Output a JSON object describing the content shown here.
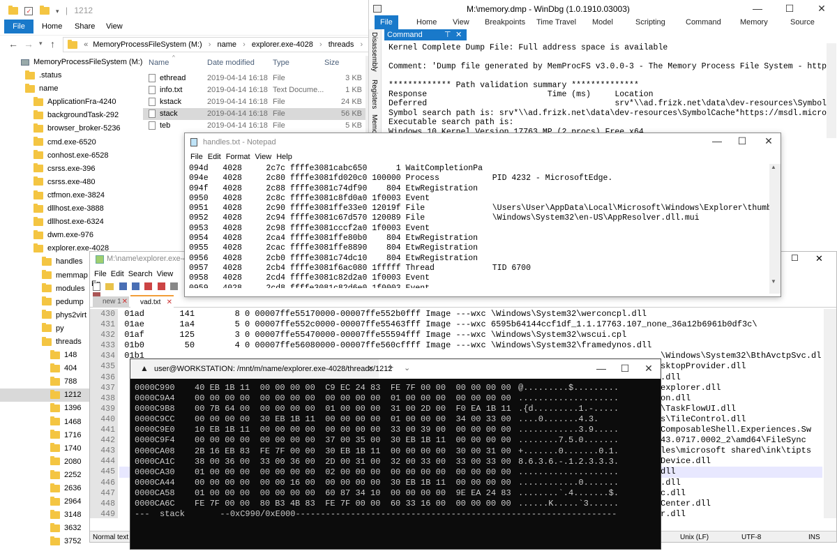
{
  "explorer": {
    "title": "1212",
    "ribbon_tabs": [
      "File",
      "Home",
      "Share",
      "View"
    ],
    "breadcrumb": [
      "MemoryProcessFileSystem (M:)",
      "name",
      "explorer.exe-4028",
      "threads",
      "1212"
    ],
    "breadcrumb_prefix": "«",
    "columns": [
      "Name",
      "Date modified",
      "Type",
      "Size"
    ],
    "files": [
      {
        "name": "ethread",
        "date": "2019-04-14 16:18",
        "type": "File",
        "size": "3 KB"
      },
      {
        "name": "info.txt",
        "date": "2019-04-14 16:18",
        "type": "Text Docume...",
        "size": "1 KB"
      },
      {
        "name": "kstack",
        "date": "2019-04-14 16:18",
        "type": "File",
        "size": "24 KB"
      },
      {
        "name": "stack",
        "date": "2019-04-14 16:18",
        "type": "File",
        "size": "56 KB"
      },
      {
        "name": "teb",
        "date": "2019-04-14 16:18",
        "type": "File",
        "size": "5 KB"
      }
    ],
    "tree": [
      {
        "label": "MemoryProcessFileSystem (M:)",
        "level": 0,
        "drive": true
      },
      {
        "label": ".status",
        "level": 1
      },
      {
        "label": "name",
        "level": 1
      },
      {
        "label": "ApplicationFra-4240",
        "level": 2
      },
      {
        "label": "backgroundTask-292",
        "level": 2
      },
      {
        "label": "browser_broker-5236",
        "level": 2
      },
      {
        "label": "cmd.exe-6520",
        "level": 2
      },
      {
        "label": "conhost.exe-6528",
        "level": 2
      },
      {
        "label": "csrss.exe-396",
        "level": 2
      },
      {
        "label": "csrss.exe-480",
        "level": 2
      },
      {
        "label": "ctfmon.exe-3824",
        "level": 2
      },
      {
        "label": "dllhost.exe-3888",
        "level": 2
      },
      {
        "label": "dllhost.exe-6324",
        "level": 2
      },
      {
        "label": "dwm.exe-976",
        "level": 2
      },
      {
        "label": "explorer.exe-4028",
        "level": 2
      },
      {
        "label": "handles",
        "level": 3
      },
      {
        "label": "memmap",
        "level": 3
      },
      {
        "label": "modules",
        "level": 3
      },
      {
        "label": "pedump",
        "level": 3
      },
      {
        "label": "phys2virt",
        "level": 3
      },
      {
        "label": "py",
        "level": 3
      },
      {
        "label": "threads",
        "level": 3
      },
      {
        "label": "148",
        "level": 4
      },
      {
        "label": "404",
        "level": 4
      },
      {
        "label": "788",
        "level": 4
      },
      {
        "label": "1212",
        "level": 4,
        "selected": true
      },
      {
        "label": "1396",
        "level": 4
      },
      {
        "label": "1468",
        "level": 4
      },
      {
        "label": "1716",
        "level": 4
      },
      {
        "label": "1740",
        "level": 4
      },
      {
        "label": "2080",
        "level": 4
      },
      {
        "label": "2252",
        "level": 4
      },
      {
        "label": "2636",
        "level": 4
      },
      {
        "label": "2964",
        "level": 4
      },
      {
        "label": "3148",
        "level": 4
      },
      {
        "label": "3632",
        "level": 4
      },
      {
        "label": "3752",
        "level": 4
      }
    ]
  },
  "windbg": {
    "title": "M:\\memory.dmp - WinDbg (1.0.1910.03003)",
    "ribbon_tabs": [
      "File",
      "Home",
      "View",
      "Breakpoints",
      "Time Travel",
      "Model",
      "Scripting",
      "Command",
      "Memory",
      "Source"
    ],
    "side_tabs": [
      "Disassembly",
      "Registers",
      "Memory"
    ],
    "panel_tab": "Command",
    "lines": [
      "Kernel Complete Dump File: Full address space is available",
      "",
      "Comment: 'Dump file generated by MemProcFS v3.0.0-3 - The Memory Process File System - https://githu",
      "",
      "************* Path validation summary **************",
      "Response                         Time (ms)     Location",
      "Deferred                                       srv*\\\\ad.frizk.net\\data\\dev-resources\\SymbolCache*htt",
      "Symbol search path is: srv*\\\\ad.frizk.net\\data\\dev-resources\\SymbolCache*https://msdl.microsoft.com/",
      "Executable search path is:",
      "Windows 10 Kernel Version 17763 MP (2 procs) Free x64"
    ]
  },
  "notepad": {
    "title": "handles.txt - Notepad",
    "menu": [
      "File",
      "Edit",
      "Format",
      "View",
      "Help"
    ],
    "lines": [
      "094d   4028     2c7c ffffe3081cabc650      1 WaitCompletionPa",
      "094e   4028     2c80 ffffe3081fd020c0 100000 Process           PID 4232 - MicrosoftEdge.",
      "094f   4028     2c88 ffffe3081c74df90    804 EtwRegistration",
      "0950   4028     2c8c ffffe3081c8fd0a0 1f0003 Event",
      "0951   4028     2c90 ffffe3081ffe33e0 12019f File              \\Users\\User\\AppData\\Local\\Microsoft\\Windows\\Explorer\\thumbcache_32.db",
      "0952   4028     2c94 ffffe3081c67d570 120089 File              \\Windows\\System32\\en-US\\AppResolver.dll.mui",
      "0953   4028     2c98 ffffe3081cccf2a0 1f0003 Event",
      "0954   4028     2ca4 ffffe3081ffe80b0    804 EtwRegistration",
      "0955   4028     2cac ffffe3081ffe8890    804 EtwRegistration",
      "0956   4028     2cb0 ffffe3081c74dc10    804 EtwRegistration",
      "0957   4028     2cb4 ffffe3081f6ac080 1fffff Thread            TID 6700",
      "0958   4028     2cd4 ffffe3081c82d2a0 1f0003 Event",
      "0959   4028     2cd8 ffffe3081c82d6e0 1f0003 Event"
    ]
  },
  "npp": {
    "title": "M:\\name\\explorer.exe-4028",
    "menu": [
      "File",
      "Edit",
      "Search",
      "View",
      "En"
    ],
    "tabs": [
      "new 1",
      "vad.txt"
    ],
    "status": [
      "Normal text fi",
      "Unix (LF)",
      "UTF-8",
      "INS"
    ],
    "line_numbers": [
      "430",
      "431",
      "432",
      "433",
      "434",
      "435",
      "436",
      "437",
      "438",
      "439",
      "440",
      "441",
      "442",
      "443",
      "444",
      "445",
      "446",
      "447",
      "448",
      "449"
    ],
    "lines": [
      " 01ad       141        8 0 00007ffe55170000-00007ffe552b0fff Image ---wxc \\Windows\\System32\\werconcpl.dll",
      " 01ae       1a4        5 0 00007ffe552c0000-00007ffe55463fff Image ---wxc 6595b64144ccf1df_1.1.17763.107_none_36a12b6961b0df3c\\",
      " 01af       125        3 0 00007ffe55470000-00007ffe55594fff Image ---wxc \\Windows\\System32\\wscui.cpl",
      " 01b0        50        4 0 00007ffe56080000-00007ffe560cffff Image ---wxc \\Windows\\System32\\framedynos.dll",
      " 01b1        ",
      "",
      "",
      "",
      "",
      "",
      "",
      "",
      "",
      "",
      "",
      "",
      "",
      "",
      "",
      ""
    ],
    "right_fragments": [
      "",
      "",
      "",
      "",
      "\\Windows\\System32\\BthAvctpSvc.dll",
      "sktopProvider.dll",
      ".dll",
      "explorer.dll",
      "on.dll",
      "\\TaskFlowUI.dll",
      "s\\TileControl.dll",
      "ComposableShell.Experiences.Sw",
      "43.0717.0002_2\\amd64\\FileSync",
      "les\\microsoft shared\\ink\\tipts",
      "Device.dll",
      "dll",
      ".dll",
      "c.dll",
      "Center.dll",
      "r.dll"
    ]
  },
  "terminal": {
    "title": "user@WORKSTATION: /mnt/m/name/explorer.exe-4028/threads/1212",
    "new_tab": "+",
    "rows": [
      {
        "addr": "0000C990",
        "hex": "40 EB 1B 11  00 00 00 00  C9 EC 24 83  FE 7F 00 00  00 00 00 00",
        "ascii": "@.........$........."
      },
      {
        "addr": "0000C9A4",
        "hex": "00 00 00 00  00 00 00 00  00 00 00 00  01 00 00 00  00 00 00 00",
        "ascii": "...................."
      },
      {
        "addr": "0000C9B8",
        "hex": "00 7B 64 00  00 00 00 00  01 00 00 00  31 00 2D 00  F0 EA 1B 11",
        "ascii": ".{d.........1.-....."
      },
      {
        "addr": "0000C9CC",
        "hex": "00 00 00 00  30 EB 1B 11  00 00 00 00  01 00 00 00  34 00 33 00",
        "ascii": "....0.......4.3."
      },
      {
        "addr": "0000C9E0",
        "hex": "10 EB 1B 11  00 00 00 00  00 00 00 00  33 00 39 00  00 00 00 00",
        "ascii": "............3.9....."
      },
      {
        "addr": "0000C9F4",
        "hex": "00 00 00 00  00 00 00 00  37 00 35 00  30 EB 1B 11  00 00 00 00",
        "ascii": "........7.5.0......."
      },
      {
        "addr": "0000CA08",
        "hex": "2B 16 EB 83  FE 7F 00 00  30 EB 1B 11  00 00 00 00  30 00 31 00",
        "ascii": "+.......0.......0.1."
      },
      {
        "addr": "0000CA1C",
        "hex": "38 00 36 00  33 00 36 00  2D 00 31 00  32 00 33 00  33 00 33 00",
        "ascii": "8.6.3.6.-.1.2.3.3.3."
      },
      {
        "addr": "0000CA30",
        "hex": "01 00 00 00  00 00 00 00  02 00 00 00  00 00 00 00  00 00 00 00",
        "ascii": "...................."
      },
      {
        "addr": "0000CA44",
        "hex": "00 00 00 00  00 00 16 00  00 00 00 00  30 EB 1B 11  00 00 00 00",
        "ascii": "............0......."
      },
      {
        "addr": "0000CA58",
        "hex": "01 00 00 00  00 00 00 00  60 87 34 10  00 00 00 00  9E EA 24 83",
        "ascii": "........`.4.......$."
      },
      {
        "addr": "0000CA6C",
        "hex": "FE 7F 00 00  80 B3 4B 83  FE 7F 00 00  60 33 16 00  00 00 00 00",
        "ascii": "......K.....`3......"
      }
    ],
    "status_line": "---  stack       --0xC990/0xE000----------------------------------------------------------------"
  },
  "colors": {
    "accent": "#1979ca",
    "selection": "#cce8ff",
    "terminal_bg": "#0c0c0c",
    "terminal_fg": "#cccccc"
  }
}
